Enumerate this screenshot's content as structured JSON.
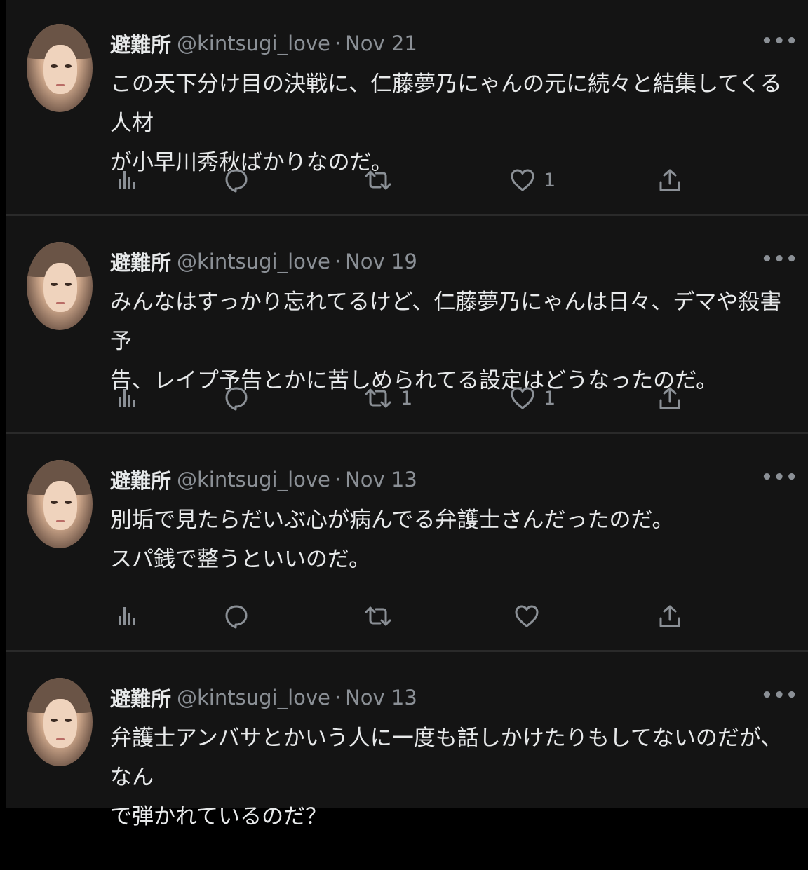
{
  "tweets": [
    {
      "name": "避難所",
      "handle": "@kintsugi_love",
      "sep": "·",
      "date": "Nov 21",
      "more": "•••",
      "text": "この天下分け目の決戦に、仁藤夢乃にゃんの元に続々と結集してくる人材\nが小早川秀秋ばかりなのだ。",
      "replies": "",
      "retweets": "",
      "likes": "1"
    },
    {
      "name": "避難所",
      "handle": "@kintsugi_love",
      "sep": "·",
      "date": "Nov 19",
      "more": "•••",
      "text": "みんなはすっかり忘れてるけど、仁藤夢乃にゃんは日々、デマや殺害予\n告、レイプ予告とかに苦しめられてる設定はどうなったのだ。",
      "replies": "",
      "retweets": "1",
      "likes": "1"
    },
    {
      "name": "避難所",
      "handle": "@kintsugi_love",
      "sep": "·",
      "date": "Nov 13",
      "more": "•••",
      "text": "別垢で見たらだいぶ心が病んでる弁護士さんだったのだ。\nスパ銭で整うといいのだ。",
      "replies": "",
      "retweets": "",
      "likes": ""
    },
    {
      "name": "避難所",
      "handle": "@kintsugi_love",
      "sep": "·",
      "date": "Nov 13",
      "more": "•••",
      "text": "弁護士アンバサとかいう人に一度も話しかけたりもしてないのだが、なん\nで弾かれているのだ？",
      "replies": "",
      "retweets": "",
      "likes": ""
    }
  ],
  "icons": {
    "views": "bar-chart-icon",
    "reply": "speech-bubble-icon",
    "retweet": "retweet-icon",
    "like": "heart-icon",
    "share": "share-upload-icon"
  },
  "colors": {
    "background": "#141414",
    "text": "#e7e9ea",
    "muted": "#8b9096",
    "divider": "#2a2a2a"
  }
}
